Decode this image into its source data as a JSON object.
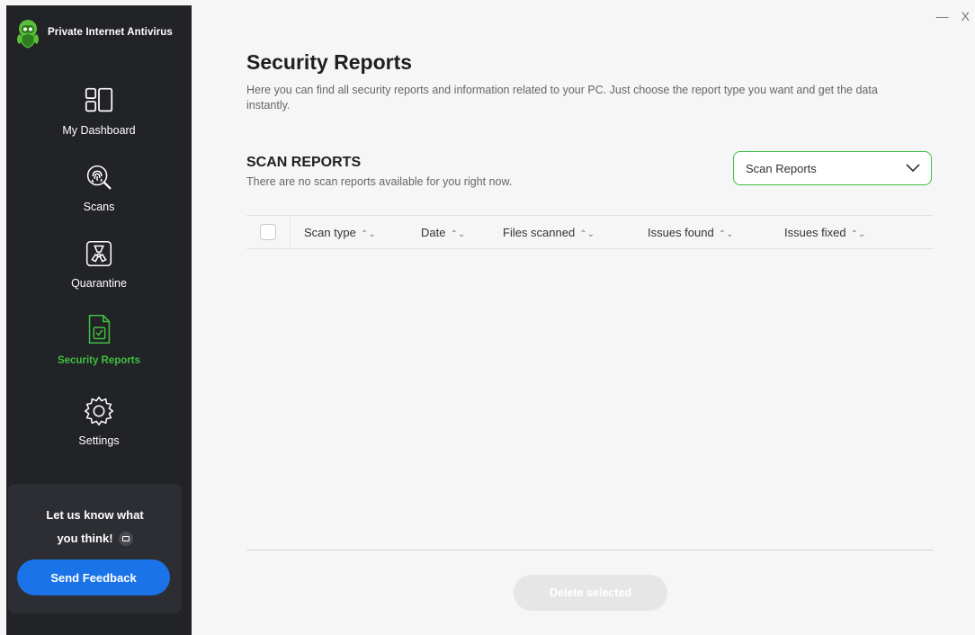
{
  "app": {
    "title": "Private Internet Antivirus"
  },
  "window_controls": {
    "minimize": "—",
    "close": "X"
  },
  "sidebar": {
    "items": [
      {
        "label": "My Dashboard",
        "icon": "dashboard-icon",
        "active": false
      },
      {
        "label": "Scans",
        "icon": "fingerprint-scan-icon",
        "active": false
      },
      {
        "label": "Quarantine",
        "icon": "biohazard-icon",
        "active": false
      },
      {
        "label": "Security Reports",
        "icon": "report-document-icon",
        "active": true
      },
      {
        "label": "Settings",
        "icon": "gear-icon",
        "active": false
      }
    ],
    "feedback": {
      "line1": "Let us know what",
      "line2": "you think!",
      "button": "Send Feedback"
    }
  },
  "main": {
    "title": "Security Reports",
    "description": "Here you can find all security reports and information related to your PC. Just choose the report type you want and get the data instantly.",
    "section_title": "SCAN REPORTS",
    "section_subtitle": "There are no scan reports available for you right now.",
    "report_type_select": {
      "value": "Scan Reports"
    },
    "table": {
      "columns": [
        "Scan type",
        "Date",
        "Files scanned",
        "Issues found",
        "Issues fixed"
      ],
      "rows": []
    },
    "delete_button": "Delete selected"
  },
  "colors": {
    "accent": "#3fbf3f",
    "sidebar_bg": "#222327",
    "feedback_button": "#1a73e8"
  }
}
